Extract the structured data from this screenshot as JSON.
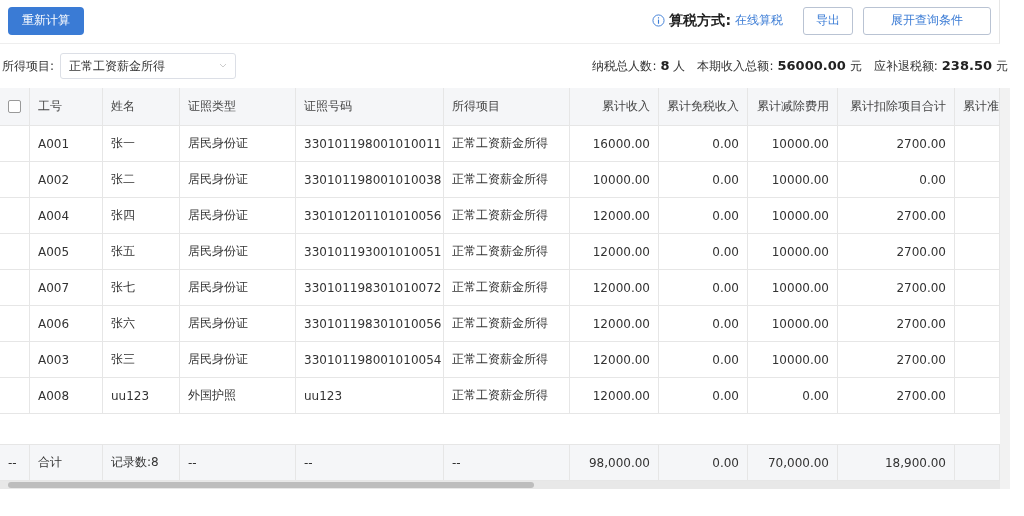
{
  "toolbar": {
    "recalc_button": "重新计算",
    "tax_method_label": "算税方式:",
    "tax_method_value": "在线算税",
    "export_button": "导出",
    "expand_button": "展开查询条件"
  },
  "filter": {
    "label": "所得项目:",
    "value": "正常工资薪金所得"
  },
  "summary": {
    "count_label": "纳税总人数:",
    "count_value": "8",
    "count_unit": "人",
    "income_label": "本期收入总额:",
    "income_value": "56000.00",
    "income_unit": "元",
    "tax_label": "应补退税额:",
    "tax_value": "238.50",
    "tax_unit": "元"
  },
  "table": {
    "select_all": {
      "checked": false
    },
    "columns": [
      "工号",
      "姓名",
      "证照类型",
      "证照号码",
      "所得项目",
      "累计收入",
      "累计免税收入",
      "累计减除费用",
      "累计扣除项目合计",
      "累计准"
    ],
    "rows": [
      [
        "A001",
        "张一",
        "居民身份证",
        "330101198001010011",
        "正常工资薪金所得",
        "16000.00",
        "0.00",
        "10000.00",
        "2700.00"
      ],
      [
        "A002",
        "张二",
        "居民身份证",
        "330101198001010038",
        "正常工资薪金所得",
        "10000.00",
        "0.00",
        "10000.00",
        "0.00"
      ],
      [
        "A004",
        "张四",
        "居民身份证",
        "330101201101010056",
        "正常工资薪金所得",
        "12000.00",
        "0.00",
        "10000.00",
        "2700.00"
      ],
      [
        "A005",
        "张五",
        "居民身份证",
        "330101193001010051",
        "正常工资薪金所得",
        "12000.00",
        "0.00",
        "10000.00",
        "2700.00"
      ],
      [
        "A007",
        "张七",
        "居民身份证",
        "330101198301010072",
        "正常工资薪金所得",
        "12000.00",
        "0.00",
        "10000.00",
        "2700.00"
      ],
      [
        "A006",
        "张六",
        "居民身份证",
        "330101198301010056",
        "正常工资薪金所得",
        "12000.00",
        "0.00",
        "10000.00",
        "2700.00"
      ],
      [
        "A003",
        "张三",
        "居民身份证",
        "330101198001010054",
        "正常工资薪金所得",
        "12000.00",
        "0.00",
        "10000.00",
        "2700.00"
      ],
      [
        "A008",
        "uu123",
        "外国护照",
        "uu123",
        "正常工资薪金所得",
        "12000.00",
        "0.00",
        "0.00",
        "2700.00"
      ]
    ],
    "totals": [
      "--",
      "合计",
      "记录数:8",
      "--",
      "--",
      "--",
      "98,000.00",
      "0.00",
      "70,000.00",
      "18,900.00"
    ]
  }
}
